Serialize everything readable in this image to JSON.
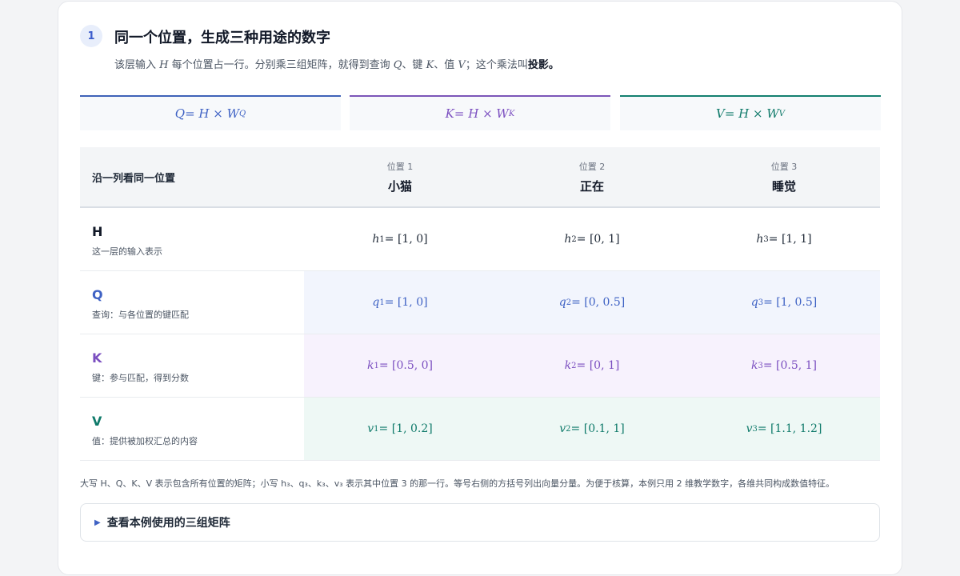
{
  "section": {
    "step": "1",
    "title": "同一个位置，生成三种用途的数字",
    "desc_prefix": "该层输入 ",
    "desc_H": "H",
    "desc_mid1": " 每个位置占一行。分别乘三组矩阵，就得到查询 ",
    "desc_Q": "Q",
    "desc_mid2": "、键 ",
    "desc_K": "K",
    "desc_mid3": "、值 ",
    "desc_V": "V",
    "desc_mid4": "；这个乘法叫",
    "desc_bold": "投影。"
  },
  "formulas": [
    {
      "lhs": "Q",
      "eq": " = H × W",
      "sub": "Q",
      "color": "#3f62c4"
    },
    {
      "lhs": "K",
      "eq": " = H × W",
      "sub": "K",
      "color": "#7b4fc0"
    },
    {
      "lhs": "V",
      "eq": " = H × W",
      "sub": "V",
      "color": "#0f7a6a"
    }
  ],
  "table": {
    "row_header": "沿一列看同一位置",
    "columns": [
      {
        "pos": "位置 1",
        "word": "小猫"
      },
      {
        "pos": "位置 2",
        "word": "正在"
      },
      {
        "pos": "位置 3",
        "word": "睡觉"
      }
    ],
    "rows": [
      {
        "sym": "H",
        "desc": "这一层的输入表示",
        "cells": [
          {
            "v": "h",
            "i": "1",
            "val": " = [1, 0]"
          },
          {
            "v": "h",
            "i": "2",
            "val": " = [0, 1]"
          },
          {
            "v": "h",
            "i": "3",
            "val": " = [1, 1]"
          }
        ]
      },
      {
        "sym": "Q",
        "desc": "查询：与各位置的键匹配",
        "cells": [
          {
            "v": "q",
            "i": "1",
            "val": " = [1, 0]"
          },
          {
            "v": "q",
            "i": "2",
            "val": " = [0, 0.5]"
          },
          {
            "v": "q",
            "i": "3",
            "val": " = [1, 0.5]"
          }
        ]
      },
      {
        "sym": "K",
        "desc": "键：参与匹配，得到分数",
        "cells": [
          {
            "v": "k",
            "i": "1",
            "val": " = [0.5, 0]"
          },
          {
            "v": "k",
            "i": "2",
            "val": " = [0, 1]"
          },
          {
            "v": "k",
            "i": "3",
            "val": " = [0.5, 1]"
          }
        ]
      },
      {
        "sym": "V",
        "desc": "值：提供被加权汇总的内容",
        "cells": [
          {
            "v": "v",
            "i": "1",
            "val": " = [1, 0.2]"
          },
          {
            "v": "v",
            "i": "2",
            "val": " = [0.1, 1]"
          },
          {
            "v": "v",
            "i": "3",
            "val": " = [1.1, 1.2]"
          }
        ]
      }
    ]
  },
  "footnote": "大写 H、Q、K、V 表示包含所有位置的矩阵；小写 h₃、q₃、k₃、v₃ 表示其中位置 3 的那一行。等号右侧的方括号列出向量分量。为便于核算，本例只用 2 维教学数字，各维共同构成数值特征。",
  "details": {
    "icon": "triangle-right-icon",
    "label": "查看本例使用的三组矩阵"
  }
}
